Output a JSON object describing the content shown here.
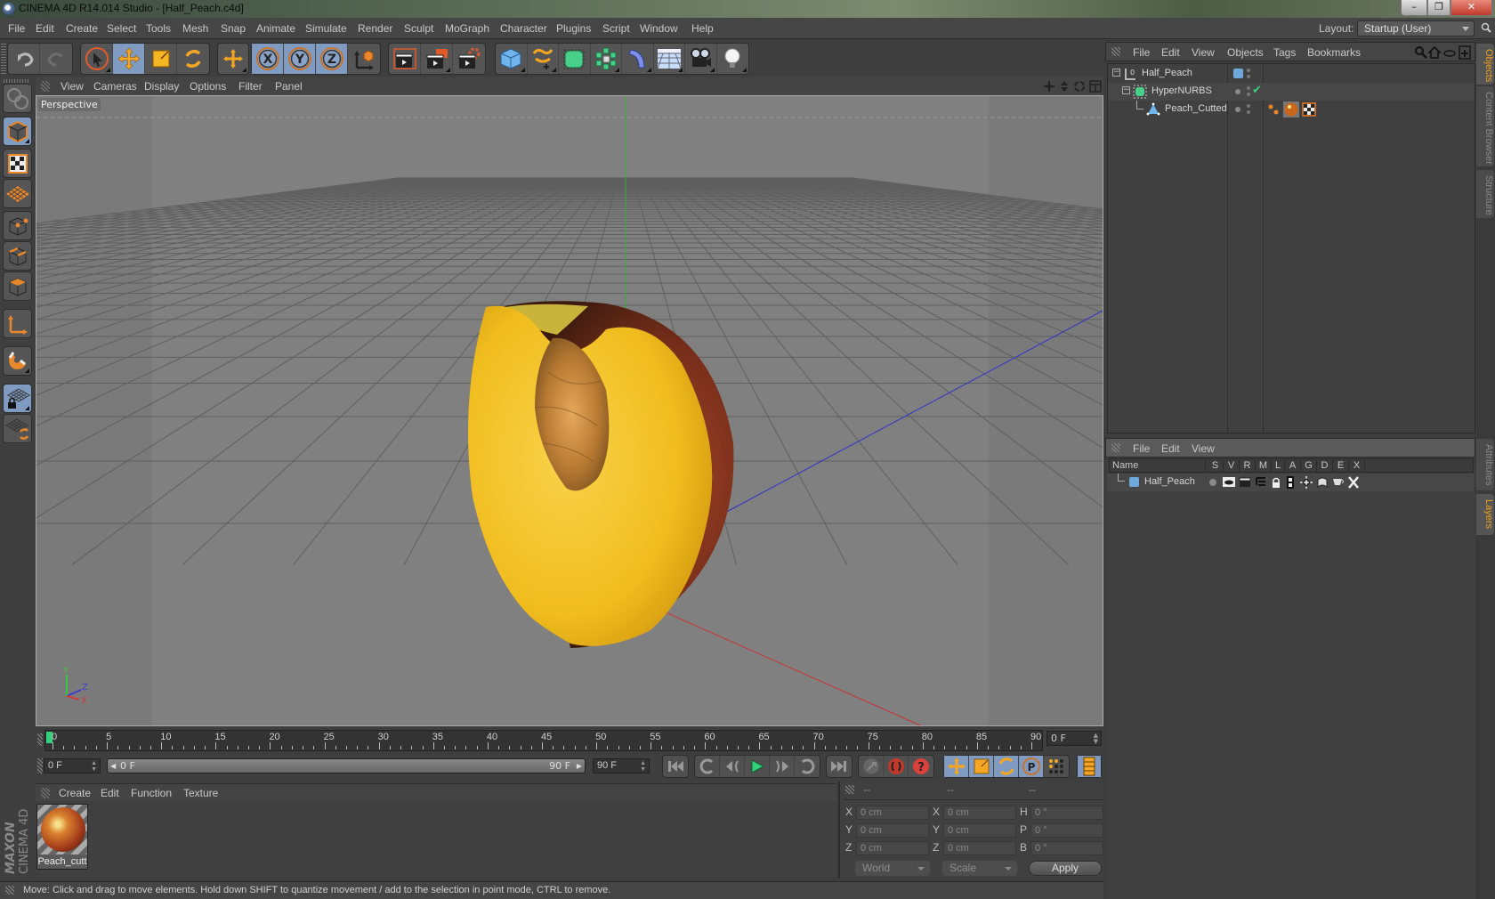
{
  "window": {
    "title": "CINEMA 4D R14.014 Studio - [Half_Peach.c4d]",
    "controls": {
      "minimize": "–",
      "maximize": "❐",
      "close": "✕"
    }
  },
  "menubar": {
    "items": [
      "File",
      "Edit",
      "Create",
      "Select",
      "Tools",
      "Mesh",
      "Snap",
      "Animate",
      "Simulate",
      "Render",
      "Sculpt",
      "MoGraph",
      "Character",
      "Plugins",
      "Script",
      "Window",
      "Help"
    ],
    "layout_label": "Layout:",
    "layout_value": "Startup (User)"
  },
  "toolbar": {
    "groups": [
      {
        "name": "history",
        "items": [
          "undo-icon",
          "redo-icon"
        ]
      },
      {
        "name": "tools",
        "items": [
          "live-selection-icon",
          "move-icon",
          "scale-icon",
          "rotate-icon"
        ]
      },
      {
        "name": "recent",
        "items": [
          "recent-tool-icon"
        ]
      },
      {
        "name": "axis-lock",
        "items": [
          "x-axis-icon",
          "y-axis-icon",
          "z-axis-icon",
          "coordinate-system-icon"
        ]
      },
      {
        "name": "render",
        "items": [
          "render-view-icon",
          "render-picture-viewer-icon",
          "render-settings-icon"
        ]
      },
      {
        "name": "objects",
        "items": [
          "cube-icon",
          "spline-pen-icon",
          "subdivision-surface-icon",
          "mograph-cloner-icon",
          "deformer-bend-icon",
          "floor-icon",
          "camera-icon",
          "light-icon"
        ]
      }
    ],
    "axis_labels": [
      "X",
      "Y",
      "Z"
    ]
  },
  "left_palette": {
    "items": [
      "make-editable-icon",
      "model-mode-icon",
      "texture-mode-icon",
      "workplane-mode-icon",
      "points-mode-icon",
      "edges-mode-icon",
      "polygons-mode-icon",
      "axis-mode-icon",
      "magnet-icon",
      "locked-workplane-icon",
      "snap-workplane-icon"
    ]
  },
  "viewport": {
    "menu": [
      "View",
      "Cameras",
      "Display",
      "Options",
      "Filter",
      "Panel"
    ],
    "label": "Perspective",
    "nav_icons": [
      "pan-icon",
      "dolly-icon",
      "orbit-icon",
      "maximize-view-icon"
    ],
    "axis_gizmo": {
      "y": "Y",
      "z": "Z",
      "x": "X"
    },
    "colors": {
      "x_axis": "#d23c3c",
      "y_axis": "#3cc83c",
      "z_axis": "#3c3cd2",
      "grid": "#5f5f5f",
      "background": "#808080"
    }
  },
  "timeline": {
    "ticks": [
      0,
      5,
      10,
      15,
      20,
      25,
      30,
      35,
      40,
      45,
      50,
      55,
      60,
      65,
      70,
      75,
      80,
      85,
      90
    ],
    "max_frame": 90,
    "current_frame": "0 F",
    "start_field": "0 F",
    "range_start": "0 F",
    "range_end": "90 F",
    "end_field": "90 F",
    "playback": [
      "goto-start-icon",
      "prev-keyframe-icon",
      "prev-frame-icon",
      "play-icon",
      "next-frame-icon",
      "next-keyframe-icon",
      "goto-end-icon"
    ],
    "record": [
      "record-active-icon",
      "autokey-icon",
      "keyframe-selection-icon"
    ],
    "key_types": [
      "key-position-icon",
      "key-scale-icon",
      "key-rotation-icon",
      "key-parameter-icon",
      "key-pla-icon"
    ],
    "timeline_window": "film-strip-icon"
  },
  "material_manager": {
    "menu": [
      "Create",
      "Edit",
      "Function",
      "Texture"
    ],
    "materials": [
      {
        "name": "Peach_cutt"
      }
    ]
  },
  "branding": {
    "line1": "MAXON",
    "line2": "CINEMA 4D"
  },
  "coordinates": {
    "headers": [
      "--",
      "--",
      "--"
    ],
    "rows": [
      {
        "pos_label": "X",
        "pos": "0 cm",
        "size_label": "X",
        "size": "0 cm",
        "rot_label": "H",
        "rot": "0 °"
      },
      {
        "pos_label": "Y",
        "pos": "0 cm",
        "size_label": "Y",
        "size": "0 cm",
        "rot_label": "P",
        "rot": "0 °"
      },
      {
        "pos_label": "Z",
        "pos": "0 cm",
        "size_label": "Z",
        "size": "0 cm",
        "rot_label": "B",
        "rot": "0 °"
      }
    ],
    "space": "World",
    "mode": "Scale",
    "apply": "Apply"
  },
  "status_bar": {
    "text": "Move: Click and drag to move elements. Hold down SHIFT to quantize movement / add to the selection in point mode, CTRL to remove."
  },
  "object_manager": {
    "menu": [
      "File",
      "Edit",
      "View",
      "Objects",
      "Tags",
      "Bookmarks"
    ],
    "tools": [
      "search-icon",
      "home-icon",
      "eye-icon",
      "new-window-icon"
    ],
    "objects": [
      {
        "name": "Half_Peach",
        "type": "null-icon",
        "indent": 0,
        "expanded": true,
        "layer_color": "#6fa8dc"
      },
      {
        "name": "HyperNURBS",
        "type": "hypernurbs-icon",
        "indent": 1,
        "expanded": true,
        "enabled_check": "✔"
      },
      {
        "name": "Peach_Cutted",
        "type": "polygon-object-icon",
        "indent": 2,
        "tags": [
          "phong-tag-icon",
          "material-tag-icon",
          "uvw-tag-icon"
        ]
      }
    ]
  },
  "layer_manager": {
    "menu": [
      "File",
      "Edit",
      "View"
    ],
    "columns": [
      "Name",
      "S",
      "V",
      "R",
      "M",
      "L",
      "A",
      "G",
      "D",
      "E",
      "X"
    ],
    "layers": [
      {
        "name": "Half_Peach",
        "color": "#6fa8dc"
      }
    ]
  },
  "side_tabs": {
    "top": [
      "Objects",
      "Content Browser",
      "Structure"
    ],
    "bottom": [
      "Attributes",
      "Layers"
    ],
    "active_top": "Objects",
    "active_bottom": "Layers"
  }
}
